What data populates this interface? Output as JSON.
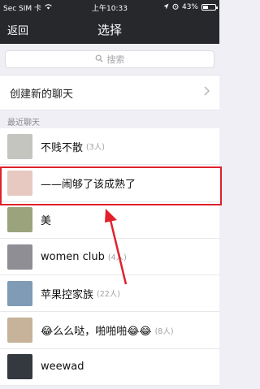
{
  "status": {
    "carrier": "Sec SIM 卡",
    "time": "上午10:33",
    "battery": "43%",
    "battery_level": 0.43
  },
  "nav": {
    "back_label": "返回",
    "title": "选择"
  },
  "search": {
    "placeholder": "搜索"
  },
  "create_chat": {
    "label": "创建新的聊天"
  },
  "section": {
    "recent_label": "最近聊天"
  },
  "chats": [
    {
      "name": "不贱不散",
      "count": "(3人)",
      "avatar": "#c4c5bf"
    },
    {
      "name": "——闹够了该成熟了",
      "count": "",
      "avatar": "#e7c9c2"
    },
    {
      "name": "美",
      "count": "",
      "avatar": "#9aa37c"
    },
    {
      "name": "women club",
      "count": "(4人)",
      "avatar": "#8f8e95"
    },
    {
      "name": "苹果控家族",
      "count": "(22人)",
      "avatar": "#7f9bb6"
    },
    {
      "name": "😂么么哒，啪啪啪😂😂",
      "count": "(8人)",
      "avatar": "#c6b39a"
    },
    {
      "name": "weewad",
      "count": "",
      "avatar": "#34383f"
    }
  ],
  "colors": {
    "nav_bg": "#27282c",
    "highlight": "#e0212c",
    "page_bg": "#f0eff5"
  }
}
